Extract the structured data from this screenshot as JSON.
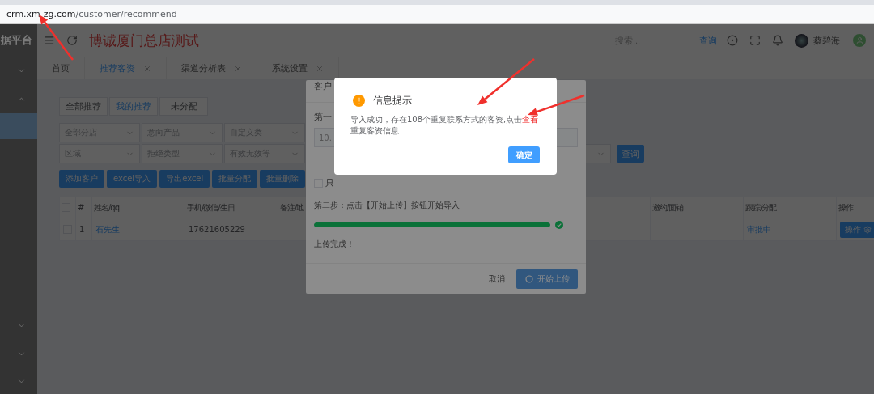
{
  "browser": {
    "url_host": "crm.xm-zg.com",
    "url_path": "/customer/recommend"
  },
  "sidebar": {
    "brand": "据平台",
    "top_groups": [
      {
        "expanded": false
      },
      {
        "expanded": true,
        "children": [
          {
            "selected": true
          }
        ]
      }
    ],
    "bottom_groups": [
      {
        "expanded": false
      },
      {
        "expanded": false
      },
      {
        "expanded": false
      }
    ]
  },
  "header": {
    "title": "博诚厦门总店测试",
    "search": {
      "placeholder": "搜索..."
    },
    "search_link": "查询",
    "user": "蔡碧海"
  },
  "tabs": [
    {
      "label": "首页",
      "selected": false,
      "closable": false
    },
    {
      "label": "推荐客资",
      "selected": true,
      "closable": true
    },
    {
      "label": "渠道分析表",
      "selected": false,
      "closable": true
    },
    {
      "label": "系统设置",
      "selected": false,
      "closable": true
    }
  ],
  "segments": [
    {
      "label": "全部推荐",
      "selected": false
    },
    {
      "label": "我的推荐",
      "selected": true
    },
    {
      "label": "未分配",
      "selected": false
    }
  ],
  "filters": {
    "rows": [
      [
        {
          "placeholder": "全部分店"
        },
        {
          "placeholder": "意向产品"
        },
        {
          "placeholder": "自定义类"
        }
      ],
      [
        {
          "placeholder": "区域"
        },
        {
          "placeholder": "拒绝类型"
        },
        {
          "placeholder": "有效无效等"
        }
      ]
    ],
    "query_button": "查询"
  },
  "actions": [
    "添加客户",
    "excel导入",
    "导出excel",
    "批量分配",
    "批量删除"
  ],
  "table": {
    "all_checked": false,
    "columns": [
      {
        "kind": "checkbox"
      },
      {
        "kind": "text",
        "label": "#"
      },
      {
        "kind": "text",
        "label": "姓名/qq"
      },
      {
        "kind": "text",
        "label": "手机/微信/生日"
      },
      {
        "kind": "text",
        "label": "备注/地"
      },
      {
        "kind": "blank"
      },
      {
        "kind": "text",
        "label": "邀约/面销"
      },
      {
        "kind": "text",
        "label": "跟踪/分配"
      },
      {
        "kind": "text",
        "label": "操作"
      }
    ],
    "rows": [
      {
        "checked": false,
        "index": "1",
        "name": "石先生",
        "phone": "17621605229",
        "status": "审批中",
        "action": "操作"
      }
    ]
  },
  "import_dialog": {
    "title": "客户",
    "step1": "第一",
    "file_value": "10.",
    "only_checkbox": {
      "label": "只",
      "checked": false
    },
    "step2": "第二步：点击【开始上传】按钮开始导入",
    "progress": {
      "level": 1
    },
    "result": "上传完成！",
    "cancel": "取消",
    "start": "开始上传"
  },
  "alert": {
    "title": "信息提示",
    "message": {
      "before": "导入成功，存在108个重复联系方式的客资,点击",
      "link": "查看",
      "after": "重复客资信息"
    },
    "confirm": "确定"
  }
}
